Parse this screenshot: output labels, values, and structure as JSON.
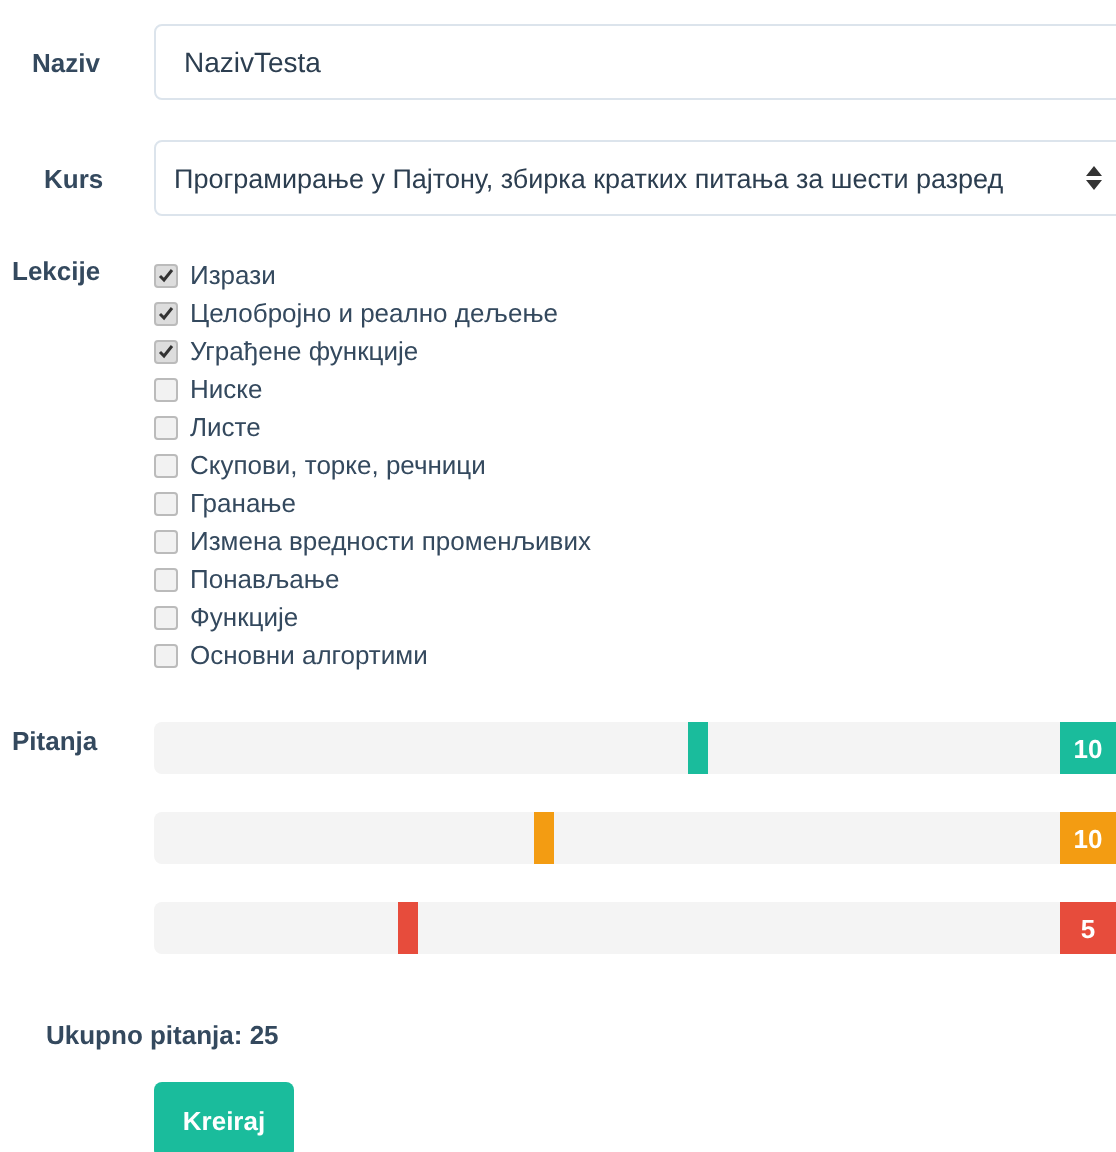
{
  "fields": [
    {
      "label": "Naziv",
      "kind": "text",
      "value": "NazivTesta"
    },
    {
      "label": "Kurs",
      "kind": "select",
      "value": "Програмирање у Пајтону, збирка кратких питања за шести разред"
    }
  ],
  "lessons": {
    "label": "Lekcije",
    "items": [
      {
        "label": "Изрази",
        "checked": true
      },
      {
        "label": "Целобројно и реално дељење",
        "checked": true
      },
      {
        "label": "Уграђене функције",
        "checked": true
      },
      {
        "label": "Ниске",
        "checked": false
      },
      {
        "label": "Листе",
        "checked": false
      },
      {
        "label": "Скупови, торке, речници",
        "checked": false
      },
      {
        "label": "Гранање",
        "checked": false
      },
      {
        "label": "Измена вредности променљивих",
        "checked": false
      },
      {
        "label": "Понављање",
        "checked": false
      },
      {
        "label": "Функције",
        "checked": false
      },
      {
        "label": "Основни алгортими",
        "checked": false
      }
    ]
  },
  "questions": {
    "label": "Pitanja",
    "sliders": [
      {
        "level": 0.59,
        "reading": "10",
        "color": "#1abc9c"
      },
      {
        "level": 0.42,
        "reading": "10",
        "color": "#f39c12"
      },
      {
        "level": 0.27,
        "reading": "5",
        "color": "#e74c3c"
      }
    ]
  },
  "total": "Ukupno pitanja: 25",
  "submit": "Kreiraj"
}
